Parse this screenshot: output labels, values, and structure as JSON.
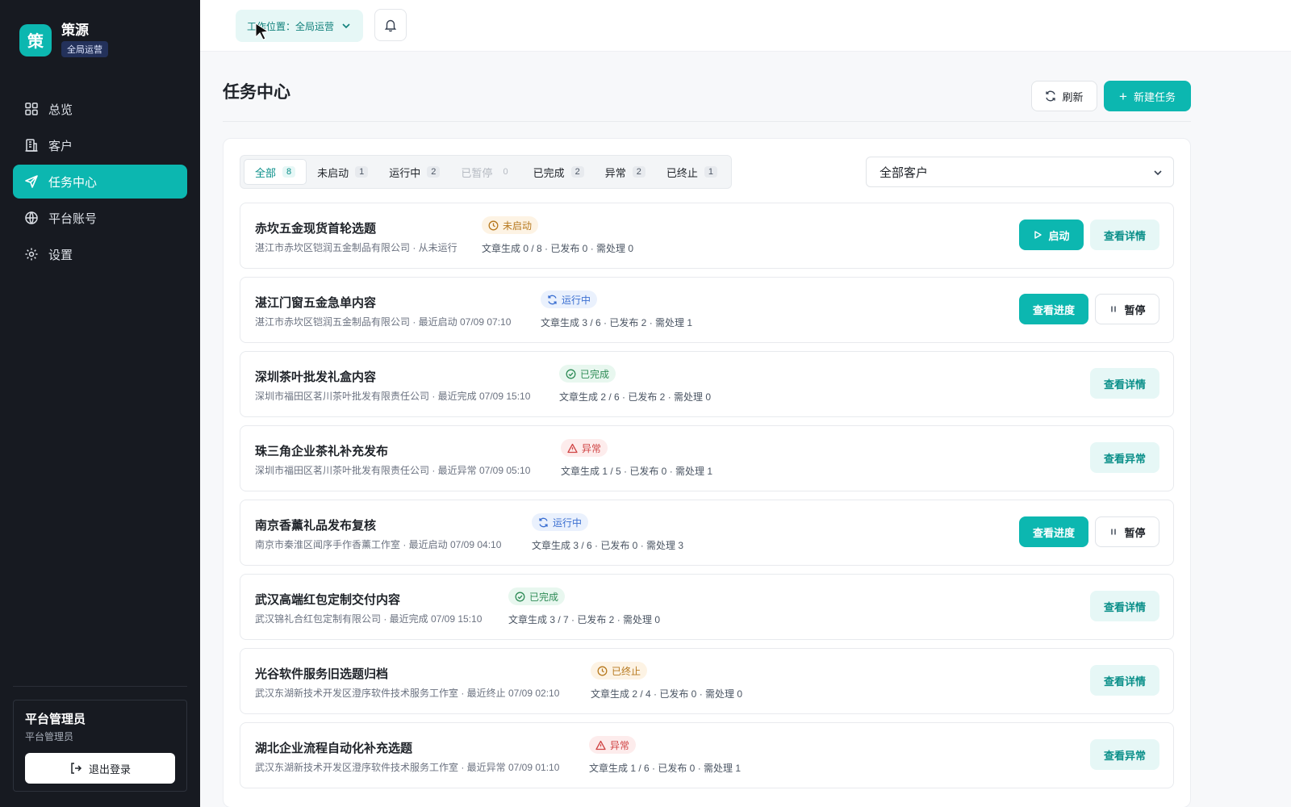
{
  "brand": {
    "logo_char": "策",
    "name": "策源",
    "badge": "全局运营"
  },
  "nav": [
    {
      "label": "总览",
      "icon": "grid-icon"
    },
    {
      "label": "客户",
      "icon": "building-icon"
    },
    {
      "label": "任务中心",
      "icon": "send-icon"
    },
    {
      "label": "平台账号",
      "icon": "globe-icon"
    },
    {
      "label": "设置",
      "icon": "gear-icon"
    }
  ],
  "user": {
    "name": "平台管理员",
    "role": "平台管理员",
    "logout_label": "退出登录"
  },
  "topbar": {
    "workspace_label": "工作位置：全局运营"
  },
  "page": {
    "title": "任务中心",
    "refresh_label": "刷新",
    "new_label": "新建任务"
  },
  "tabs": [
    {
      "label": "全部",
      "count": "8"
    },
    {
      "label": "未启动",
      "count": "1"
    },
    {
      "label": "运行中",
      "count": "2"
    },
    {
      "label": "已暂停",
      "count": "0"
    },
    {
      "label": "已完成",
      "count": "2"
    },
    {
      "label": "异常",
      "count": "2"
    },
    {
      "label": "已终止",
      "count": "1"
    }
  ],
  "client_filter": {
    "value": "全部客户"
  },
  "tasks": [
    {
      "title": "赤坎五金现货首轮选题",
      "sub": "湛江市赤坎区铠润五金制品有限公司 · 从未运行",
      "status": "未启动",
      "stats": "文章生成 0 / 8 · 已发布 0 · 需处理 0",
      "actions": [
        "启动",
        "查看详情"
      ]
    },
    {
      "title": "湛江门窗五金急单内容",
      "sub": "湛江市赤坎区铠润五金制品有限公司 · 最近启动 07/09 07:10",
      "status": "运行中",
      "stats": "文章生成 3 / 6 · 已发布 2 · 需处理 1",
      "actions": [
        "查看进度",
        "暂停"
      ]
    },
    {
      "title": "深圳茶叶批发礼盒内容",
      "sub": "深圳市福田区茗川茶叶批发有限责任公司 · 最近完成 07/09 15:10",
      "status": "已完成",
      "stats": "文章生成 2 / 6 · 已发布 2 · 需处理 0",
      "actions": [
        "查看详情"
      ]
    },
    {
      "title": "珠三角企业茶礼补充发布",
      "sub": "深圳市福田区茗川茶叶批发有限责任公司 · 最近异常 07/09 05:10",
      "status": "异常",
      "stats": "文章生成 1 / 5 · 已发布 0 · 需处理 1",
      "actions": [
        "查看异常"
      ]
    },
    {
      "title": "南京香薰礼品发布复核",
      "sub": "南京市秦淮区闻序手作香薰工作室 · 最近启动 07/09 04:10",
      "status": "运行中",
      "stats": "文章生成 3 / 6 · 已发布 0 · 需处理 3",
      "actions": [
        "查看进度",
        "暂停"
      ]
    },
    {
      "title": "武汉高端红包定制交付内容",
      "sub": "武汉锦礼合红包定制有限公司 · 最近完成 07/09 15:10",
      "status": "已完成",
      "stats": "文章生成 3 / 7 · 已发布 2 · 需处理 0",
      "actions": [
        "查看详情"
      ]
    },
    {
      "title": "光谷软件服务旧选题归档",
      "sub": "武汉东湖新技术开发区澄序软件技术服务工作室 · 最近终止 07/09 02:10",
      "status": "已终止",
      "stats": "文章生成 2 / 4 · 已发布 0 · 需处理 0",
      "actions": [
        "查看详情"
      ]
    },
    {
      "title": "湖北企业流程自动化补充选题",
      "sub": "武汉东湖新技术开发区澄序软件技术服务工作室 · 最近异常 07/09 01:10",
      "status": "异常",
      "stats": "文章生成 1 / 6 · 已发布 0 · 需处理 1",
      "actions": [
        "查看异常"
      ]
    }
  ],
  "colors": {
    "accent": "#0cb7b0",
    "sidebar_bg": "#171a21"
  }
}
